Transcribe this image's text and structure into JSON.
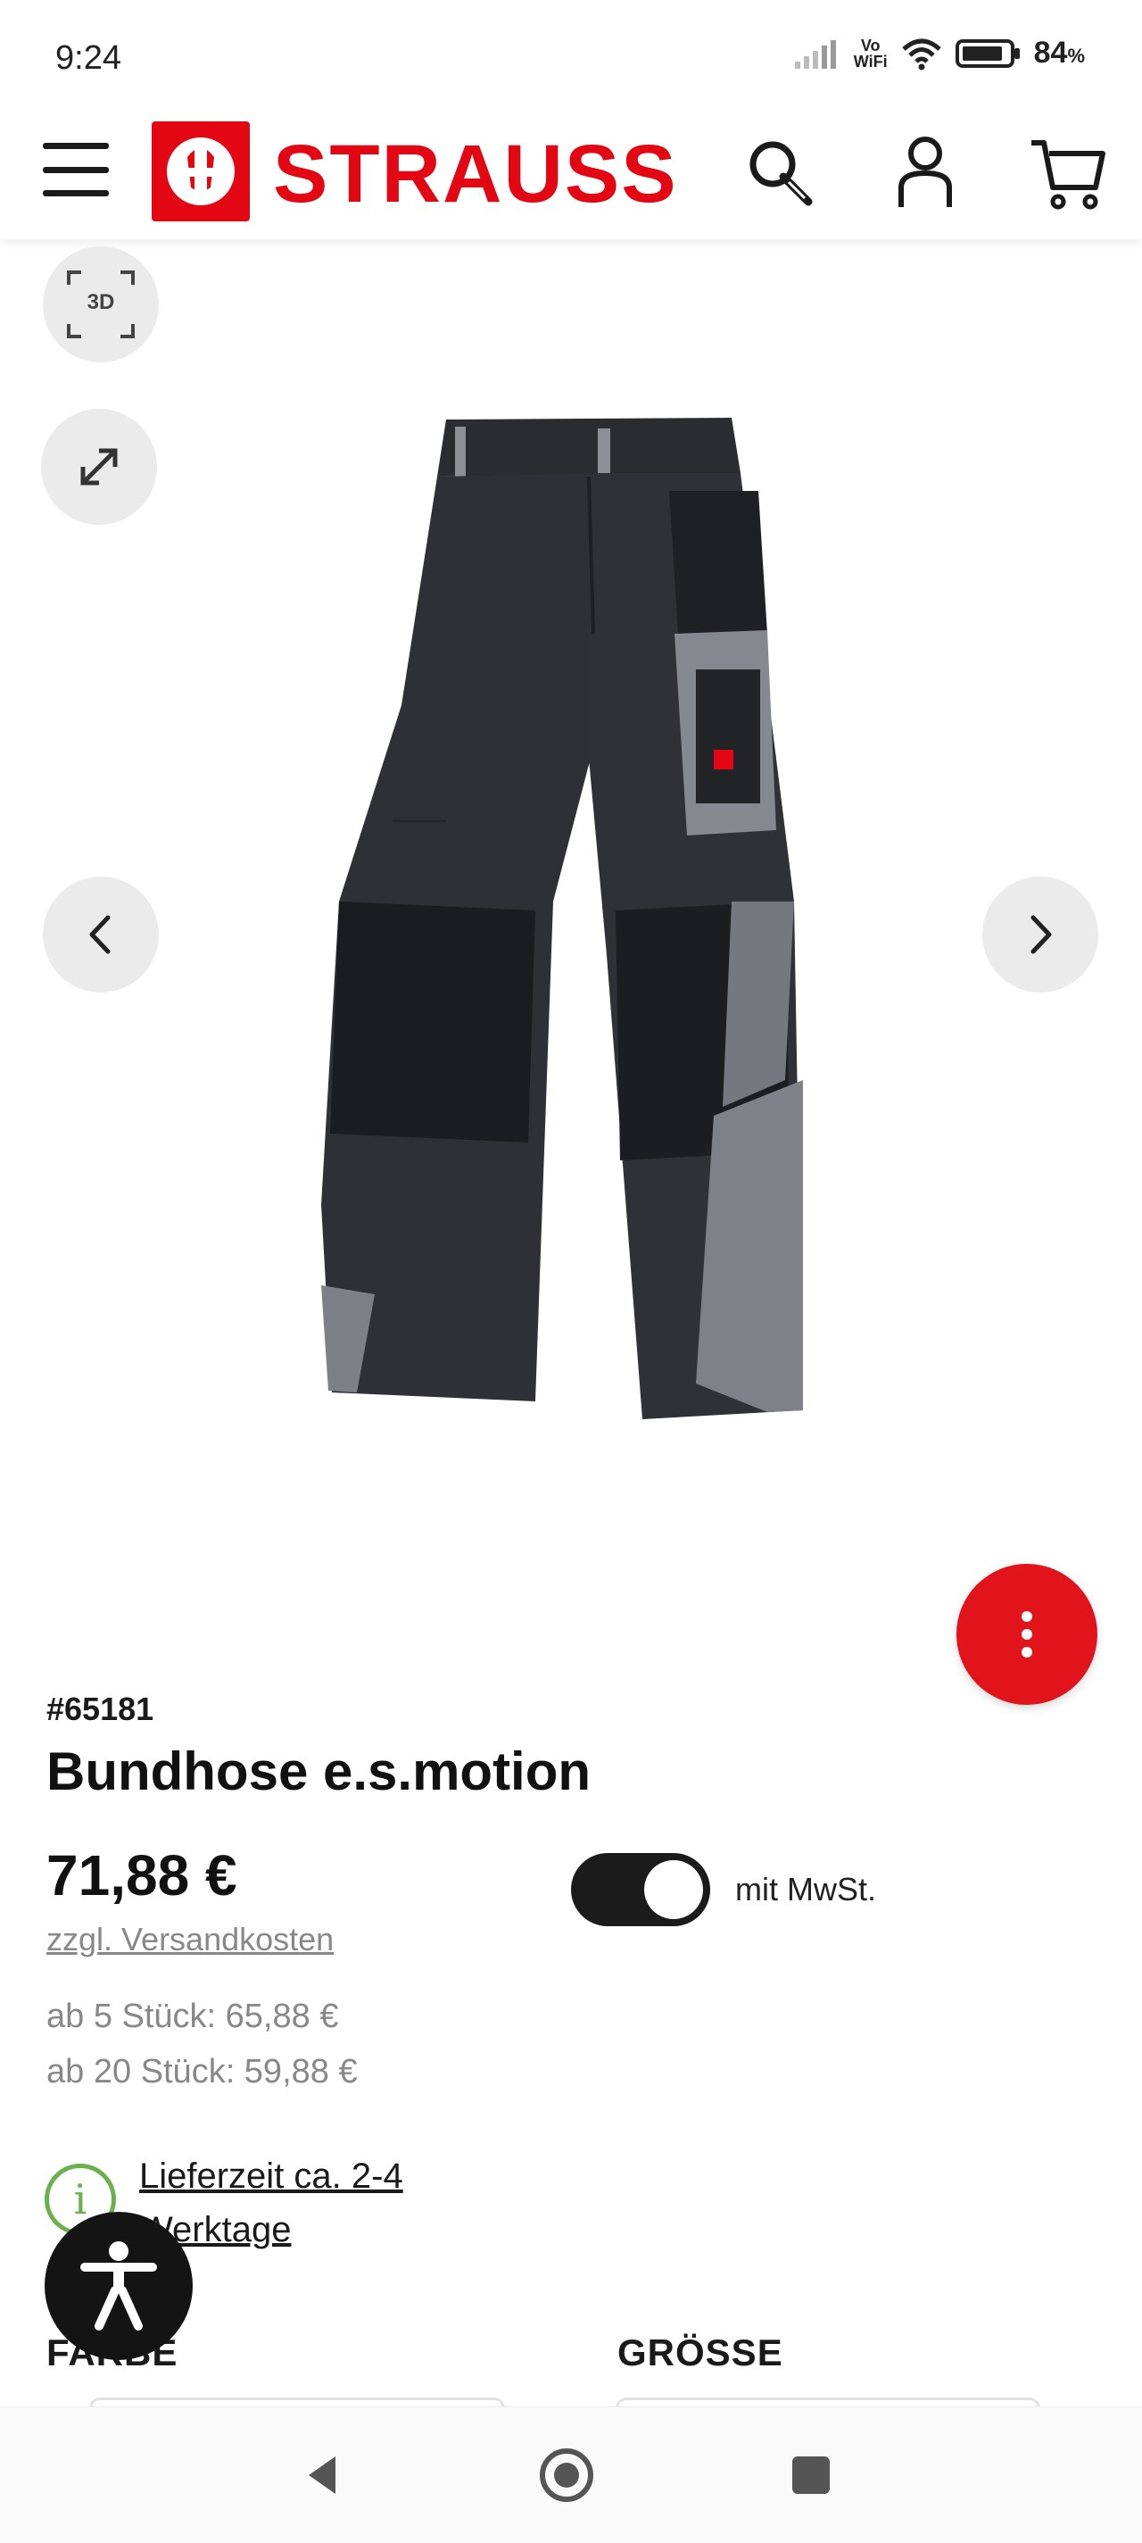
{
  "status_bar": {
    "time": "9:24",
    "network_label_top": "Vo",
    "network_label_bottom": "WiFi",
    "battery": "84",
    "battery_unit": "%"
  },
  "header": {
    "brand": "STRAUSS",
    "icons": [
      "menu-icon",
      "search-icon",
      "account-icon",
      "cart-icon"
    ],
    "brand_color": "#e30613"
  },
  "gallery": {
    "btn_3d_label": "3D",
    "icons": [
      "expand-icon",
      "chevron-left-icon",
      "chevron-right-icon",
      "more-vertical-icon"
    ]
  },
  "product": {
    "article_number": "#65181",
    "title": "Bundhose e.s.motion",
    "price": "71,88 €",
    "shipping_link": "zzgl. Versandkosten",
    "price_tiers": [
      "ab 5 Stück: 65,88 €",
      "ab 20 Stück: 59,88 €"
    ],
    "vat_toggle_label": "mit MwSt.",
    "vat_toggle_on": true,
    "delivery_text": "Lieferzeit ca. 2-4 Werktage",
    "option_labels": {
      "color": "FARBE",
      "size": "GRÖSSE"
    }
  },
  "accessibility": {
    "icon": "accessibility-icon"
  },
  "nav_bar": {
    "icons": [
      "back-icon",
      "home-icon",
      "recents-icon"
    ]
  }
}
